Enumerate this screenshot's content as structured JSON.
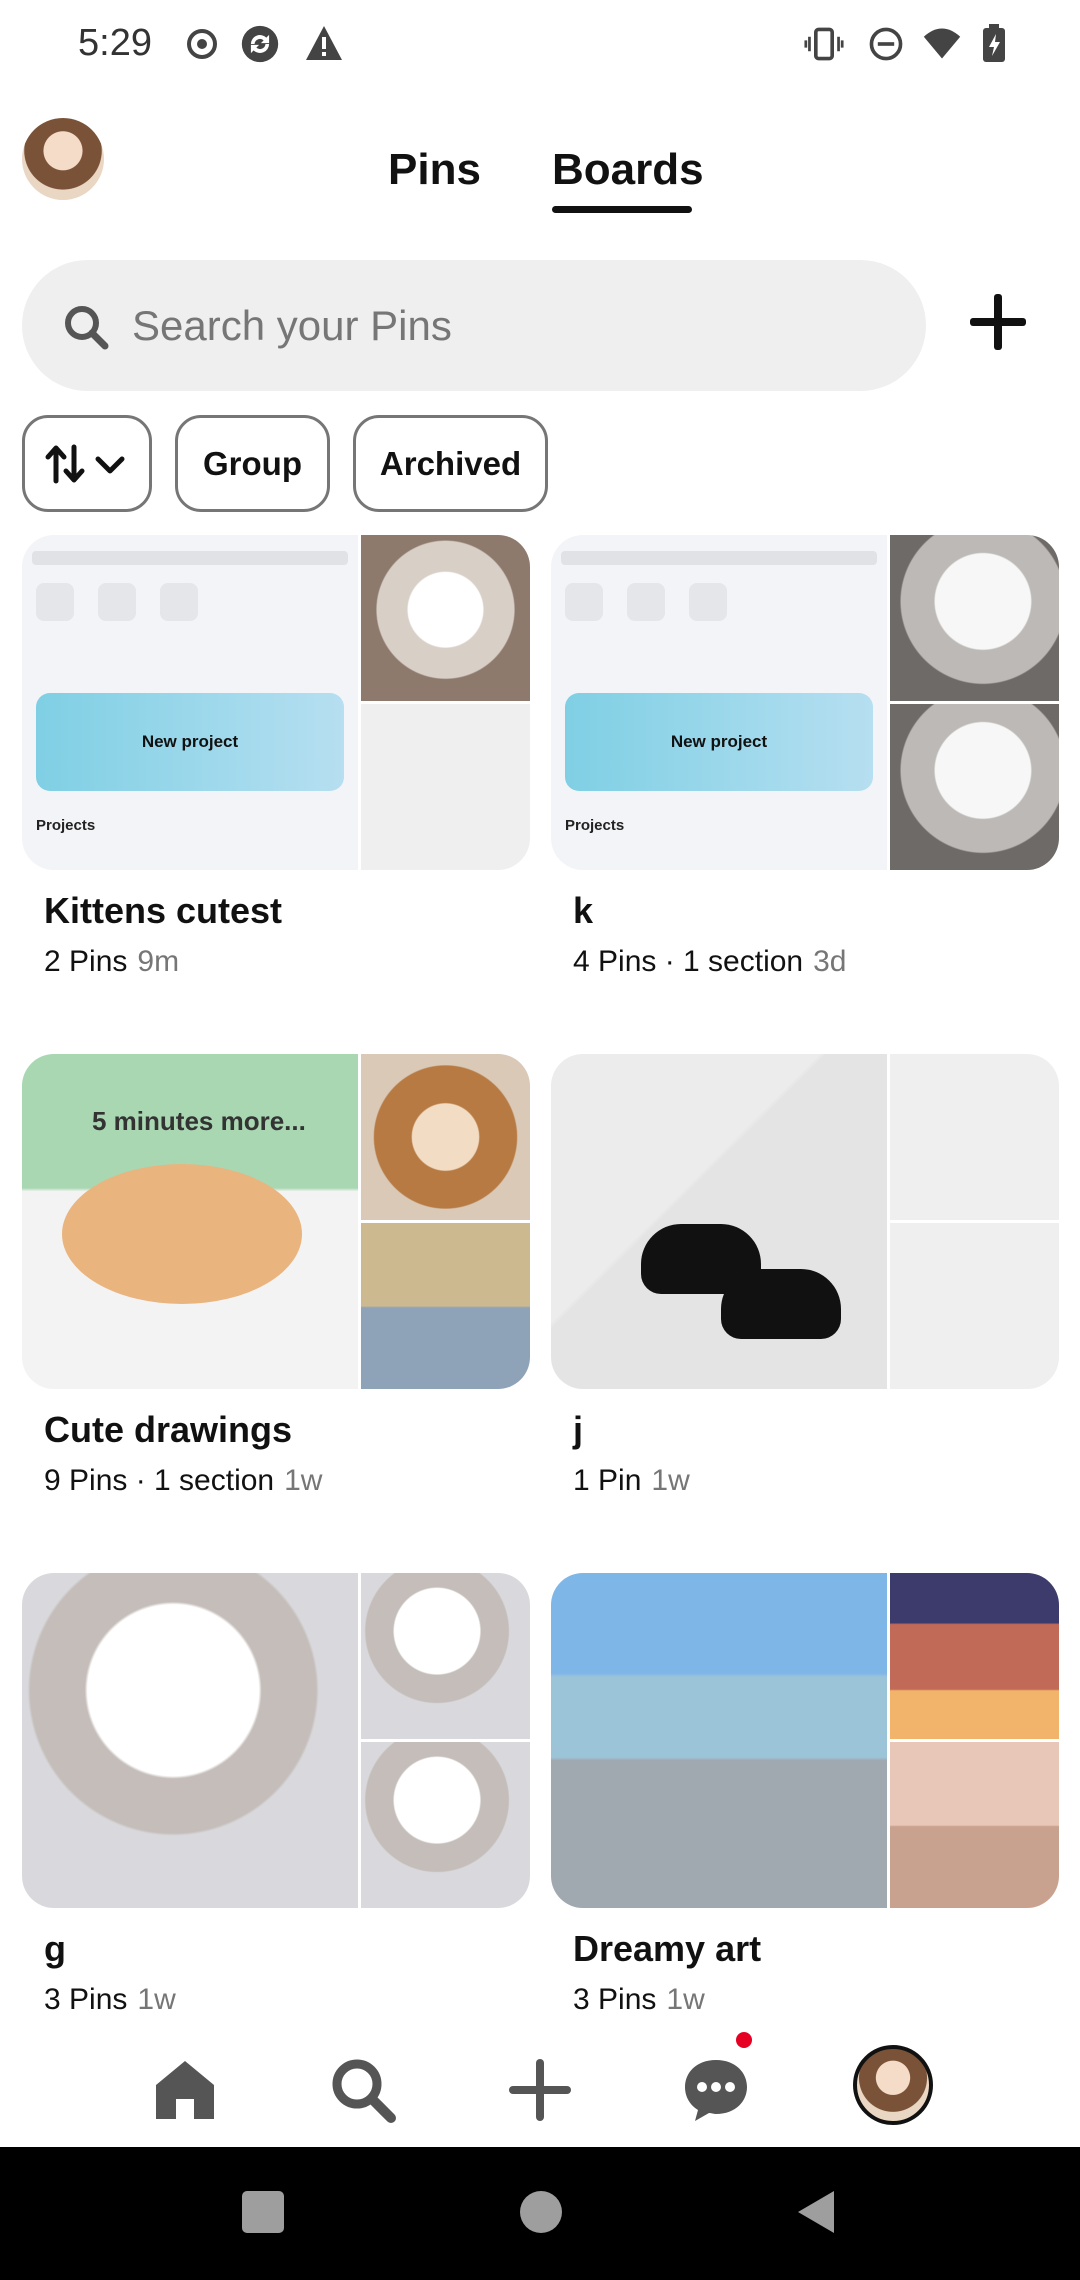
{
  "status_bar": {
    "time": "5:29"
  },
  "header": {
    "tabs": [
      {
        "label": "Pins"
      },
      {
        "label": "Boards"
      }
    ],
    "active_tab": "Boards"
  },
  "search": {
    "placeholder": "Search your Pins"
  },
  "filters": {
    "group_label": "Group",
    "archived_label": "Archived"
  },
  "boards": [
    {
      "title": "Kittens cutest",
      "meta": "2 Pins",
      "ago": "9m",
      "cover_text": {
        "button": "New project",
        "section": "Projects"
      }
    },
    {
      "title": "k",
      "meta": "4 Pins · 1 section",
      "ago": "3d",
      "cover_text": {
        "button": "New project",
        "section": "Projects"
      }
    },
    {
      "title": "Cute drawings",
      "meta": "9 Pins · 1 section",
      "ago": "1w",
      "cover_text": {
        "drawing": "5 minutes more..."
      }
    },
    {
      "title": "j",
      "meta": "1 Pin",
      "ago": "1w"
    },
    {
      "title": "g",
      "meta": "3 Pins",
      "ago": "1w"
    },
    {
      "title": "Dreamy art",
      "meta": "3 Pins",
      "ago": "1w"
    }
  ],
  "bottom_nav": {
    "items": [
      "home-icon",
      "search-icon",
      "create-icon",
      "messages-icon",
      "profile-avatar"
    ],
    "messages_has_notification": true
  },
  "colors": {
    "accent": "#e60023",
    "chip_border": "#767676",
    "search_bg": "#efefef",
    "text": "#111111",
    "muted": "#767676"
  }
}
